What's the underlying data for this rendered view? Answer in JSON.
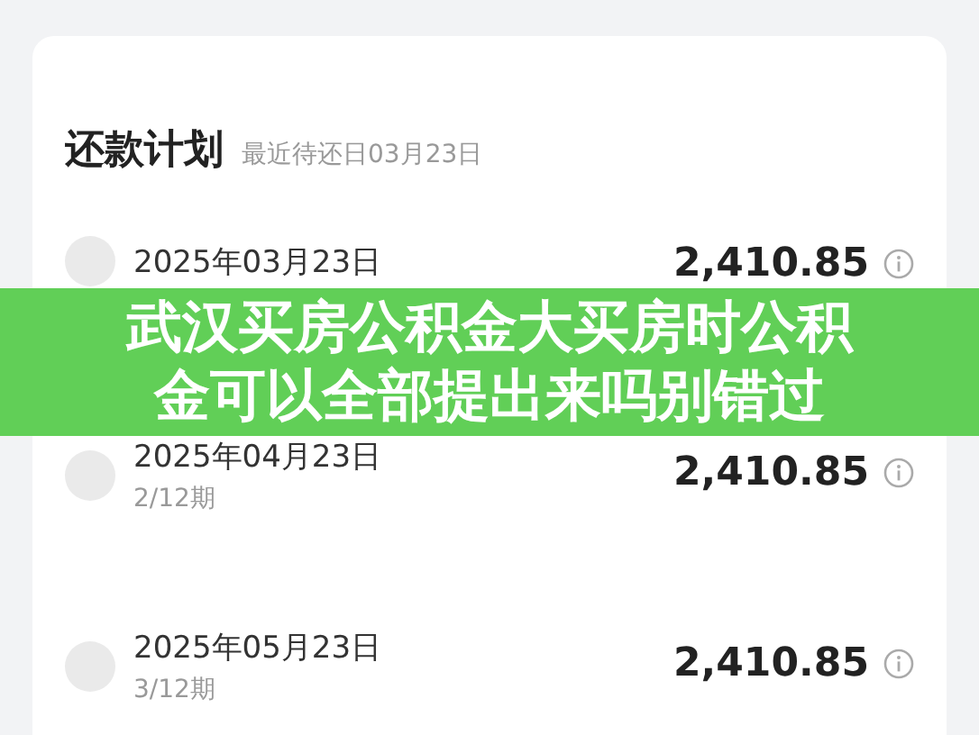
{
  "plan": {
    "title": "还款计划",
    "subtitle": "最近待还日03月23日"
  },
  "installments": [
    {
      "date": "2025年03月23日",
      "amount": "2,410.85"
    },
    {
      "date": "2025年04月23日",
      "period": "2/12期",
      "amount": "2,410.85"
    },
    {
      "date": "2025年05月23日",
      "period": "3/12期",
      "amount": "2,410.85"
    }
  ],
  "banner": {
    "lines": [
      "武汉买房公积金大买房时公积",
      "金可以全部提出来吗别错过"
    ]
  }
}
